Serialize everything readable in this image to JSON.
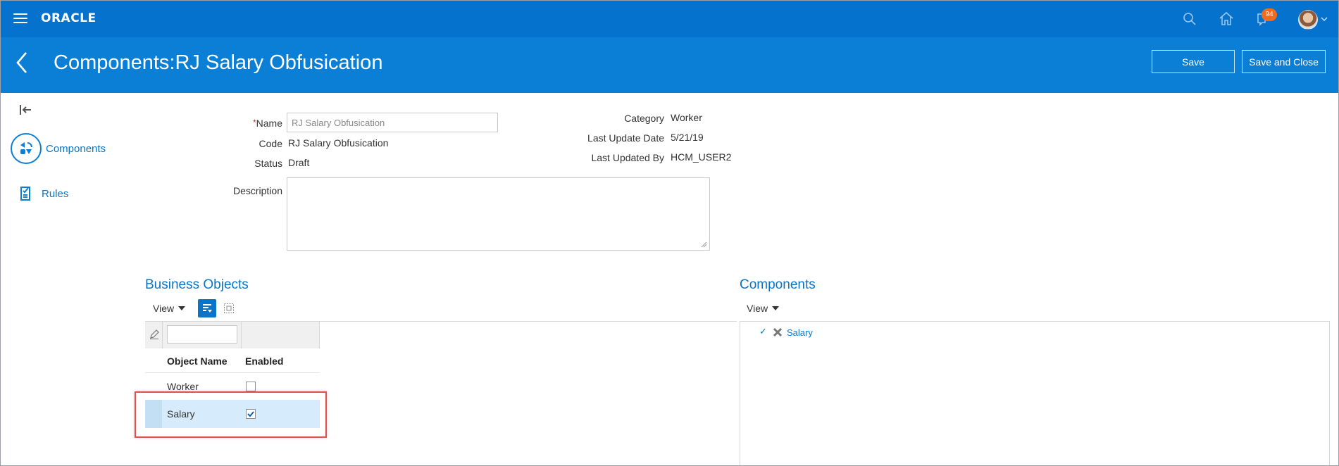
{
  "topbar": {
    "logo": "ORACLE",
    "notifications_count": "94",
    "icons": [
      "menu-icon",
      "search-icon",
      "home-icon",
      "notifications-icon",
      "avatar",
      "chevron-down-icon"
    ],
    "bar_color": "#0572ce"
  },
  "header": {
    "title": "Components:RJ Salary Obfusication",
    "save_label": "Save",
    "save_close_label": "Save and Close",
    "band_color": "#0b7fd6"
  },
  "nav": {
    "items": [
      {
        "label": "Components",
        "icon": "components-icon"
      },
      {
        "label": "Rules",
        "icon": "rules-icon"
      }
    ]
  },
  "form": {
    "name_label": "Name",
    "name_value": "RJ Salary Obfusication",
    "code_label": "Code",
    "code_value": "RJ Salary Obfusication",
    "status_label": "Status",
    "status_value": "Draft",
    "description_label": "Description",
    "category_label": "Category",
    "category_value": "Worker",
    "last_update_date_label": "Last Update Date",
    "last_update_date_value": "5/21/19",
    "last_updated_by_label": "Last Updated By",
    "last_updated_by_value": "HCM_USER2"
  },
  "business_objects": {
    "title": "Business Objects",
    "view_label": "View",
    "columns": [
      "Object Name",
      "Enabled"
    ],
    "rows": [
      {
        "name": "Worker",
        "enabled": false
      },
      {
        "name": "Salary",
        "enabled": true
      }
    ]
  },
  "components": {
    "title": "Components",
    "view_label": "View",
    "tree": [
      {
        "label": "Salary"
      }
    ]
  }
}
